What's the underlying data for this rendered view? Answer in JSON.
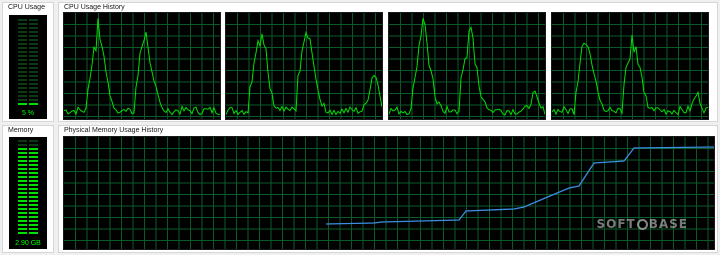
{
  "cpu_usage": {
    "title": "CPU Usage",
    "value_label": "5 %",
    "level": 0.05
  },
  "cpu_history": {
    "title": "CPU Usage History",
    "core_count": 4
  },
  "memory": {
    "title": "Memory",
    "value_label": "2.90 GB",
    "level": 0.92
  },
  "memory_history": {
    "title": "Physical Memory Usage History",
    "line_color": "#3a8fe0"
  },
  "colors": {
    "grid": "#0b5a2a",
    "cpu_line": "#00e000",
    "meter_on": "#00e000",
    "meter_off": "#0b3a14"
  },
  "watermark": {
    "left": "SOFT",
    "right": "BASE"
  }
}
